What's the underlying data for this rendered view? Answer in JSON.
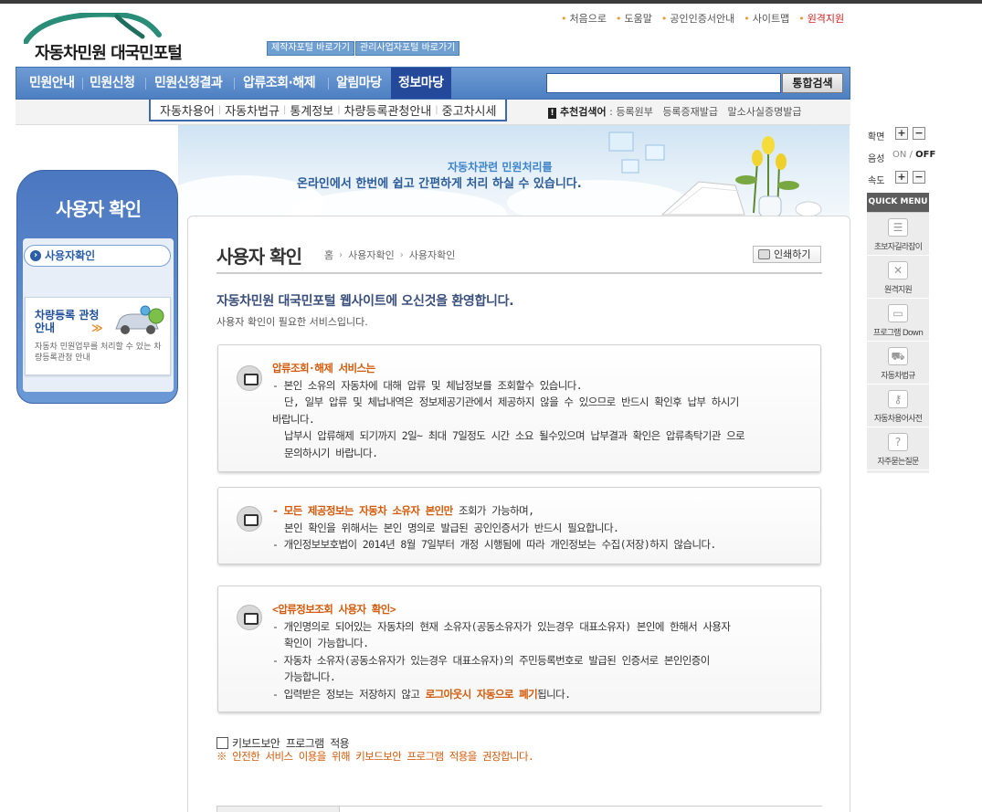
{
  "util_nav": [
    "처음으로",
    "도움말",
    "공인인증서안내",
    "사이트맵",
    "원격지원"
  ],
  "logo": {
    "text": "자동차민원 대국민포털"
  },
  "portal_links": [
    "제작자포털 바로가기",
    "관리사업자포털 바로가기"
  ],
  "main_nav": [
    "민원안내",
    "민원신청",
    "민원신청결과",
    "압류조회·해제",
    "알림마당",
    "정보마당"
  ],
  "search": {
    "button": "통합검색",
    "placeholder": ""
  },
  "sub_nav": [
    "자동차용어",
    "자동차법규",
    "통계정보",
    "차량등록관청안내",
    "중고차시세"
  ],
  "recommend": {
    "icon": "!",
    "label": "추천검색어",
    "colon": ":",
    "items": [
      "등록원부",
      "등록증재발급",
      "말소사실증명발급"
    ]
  },
  "banner": {
    "line1": "자동차관련 민원처리를",
    "line2_a": "온라인에서 한번에 쉽고 간편하게 처리 하실 수 있습니다.",
    "line2_b": ""
  },
  "sidebar": {
    "title": "사용자 확인",
    "item": "사용자확인",
    "card": {
      "title": "차량등록 관청 안내",
      "arrow": "≫",
      "desc": "자동차 민원업무를 처리할 수 있는 차량등록관청 안내"
    }
  },
  "page": {
    "title": "사용자 확인",
    "breadcrumb": [
      "홈",
      "사용자확인",
      "사용자확인"
    ],
    "print": "인쇄하기",
    "welcome": "자동차민원 대국민포털 웹사이트에 오신것을 환영합니다.",
    "welcome_sub": "사용자 확인이 필요한 서비스입니다."
  },
  "boxes": {
    "b1": {
      "head": "압류조회·해제 서비스는",
      "l1": "- 본인 소유의 자동차에 대해 압류 및 체납정보를 조회할수 있습니다.",
      "l2": "단, 일부 압류 및 체납내역은 정보제공기관에서 제공하지 않을 수 있으므로 반드시 확인후 납부 하시기",
      "l3": "바랍니다.",
      "l4": "납부시 압류해제 되기까지 2일~ 최대 7일정도 시간 소요 될수있으며 납부결과 확인은 압류촉탁기관 으로",
      "l5": "문의하시기 바랍니다."
    },
    "b2": {
      "emph": "- 모든 제공정보는 자동차 소유자 본인만",
      "l1_rest": " 조회가 가능하며,",
      "l2": "본인 확인을 위해서는 본인 명의로 발급된 공인인증서가 반드시 필요합니다.",
      "l3": "- 개인정보보호법이 2014년 8월 7일부터 개정 시행됨에 따라 개인정보는 수집(저장)하지 않습니다."
    },
    "b3": {
      "head": "<압류정보조회 사용자 확인>",
      "l1": "- 개인명의로 되어있는 자동차의 현재 소유자(공동소유자가 있는경우 대표소유자) 본인에 한해서 사용자",
      "l2": "확인이 가능합니다.",
      "l3": "- 자동차 소유자(공동소유자가 있는경우 대표소유자)의 주민등록번호로 발급된 인증서로 본인인증이",
      "l4": "가능합니다.",
      "l5_a": "- 입력받은 정보는 저장하지 않고 ",
      "l5_emph": "로그아웃시 자동으로 폐기",
      "l5_b": "됩니다."
    }
  },
  "keyboard": {
    "label": "키보드보안 프로그램 적용",
    "note": "※ 안전한 서비스 이용을 위해 키보드보안 프로그램 적용을 권장합니다."
  },
  "right_panel": {
    "zoom_label": "확면",
    "sound_label": "음성",
    "on": "ON",
    "slash": "/",
    "off": "OFF",
    "speed_label": "속도",
    "plus": "+",
    "minus": "−",
    "quick_menu_title": "QUICK MENU",
    "quick_items": [
      "초보자길라잡이",
      "원격지원",
      "프로그램 Down",
      "자동차법규",
      "자동차용어사전",
      "자주묻는질문"
    ]
  },
  "colors": {
    "nav_blue": "#4d7fc2",
    "nav_active": "#24499a",
    "accent_orange": "#d45a0a",
    "remote_support_red": "#d0201f"
  }
}
